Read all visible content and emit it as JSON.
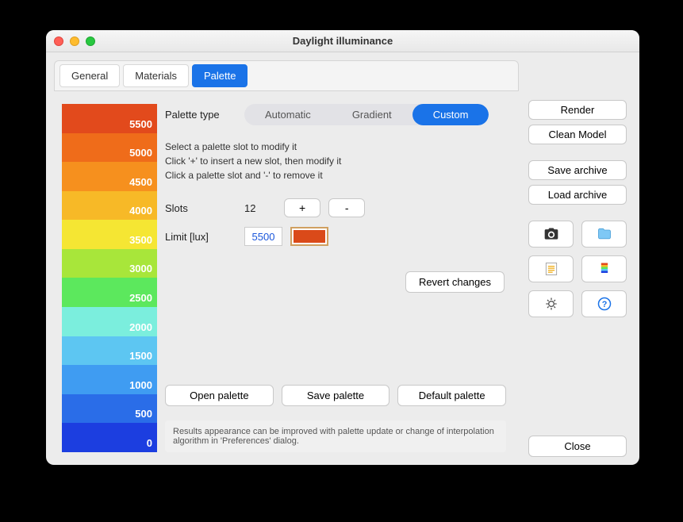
{
  "window": {
    "title": "Daylight illuminance"
  },
  "tabs": {
    "general": "General",
    "materials": "Materials",
    "palette": "Palette",
    "active": "palette"
  },
  "palette_type": {
    "label": "Palette type",
    "options": {
      "automatic": "Automatic",
      "gradient": "Gradient",
      "custom": "Custom"
    },
    "active": "custom"
  },
  "help": {
    "line1": "Select a palette slot to modify it",
    "line2": "Click '+' to insert a new slot, then modify it",
    "line3": "Click a palette slot and '-' to remove it"
  },
  "slots": {
    "label": "Slots",
    "value": "12",
    "plus": "+",
    "minus": "-"
  },
  "limit": {
    "label": "Limit [lux]",
    "value": "5500",
    "color": "#da4a19"
  },
  "buttons": {
    "revert": "Revert changes",
    "open": "Open palette",
    "save": "Save palette",
    "default": "Default palette"
  },
  "info": "Results appearance can be improved with palette update or change of interpolation algorithm in 'Preferences' dialog.",
  "swatches": [
    {
      "label": "5500",
      "color": "#e24a1c"
    },
    {
      "label": "5000",
      "color": "#ef6c1a"
    },
    {
      "label": "4500",
      "color": "#f6901e"
    },
    {
      "label": "4000",
      "color": "#f7b927"
    },
    {
      "label": "3500",
      "color": "#f5e633"
    },
    {
      "label": "3000",
      "color": "#a8e63a"
    },
    {
      "label": "2500",
      "color": "#5ce85d"
    },
    {
      "label": "2000",
      "color": "#7beedd"
    },
    {
      "label": "1500",
      "color": "#5dc6f2"
    },
    {
      "label": "1000",
      "color": "#3f9cf2"
    },
    {
      "label": "500",
      "color": "#2a6de8"
    },
    {
      "label": "0",
      "color": "#1c3ee0"
    }
  ],
  "sidebar": {
    "render": "Render",
    "clean": "Clean Model",
    "save_archive": "Save archive",
    "load_archive": "Load archive",
    "close": "Close"
  }
}
